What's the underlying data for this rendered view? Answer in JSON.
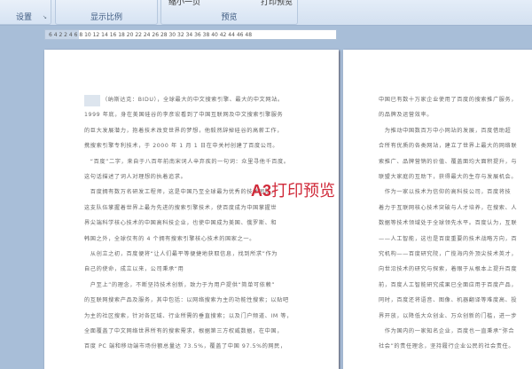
{
  "ribbon": {
    "groups": [
      {
        "label": "设置"
      },
      {
        "label": "显示比例"
      },
      {
        "label": "预览"
      }
    ],
    "buttons": {
      "prev_page": "缩小一页",
      "print_preview": "打印预览"
    }
  },
  "ruler": {
    "ticks": "6  4  2      2   4   6   8  10  12  14  16  18  20  22  24  26  28  30  32  34  36  38  40  42  44  46  48"
  },
  "watermark": {
    "prefix": "A3",
    "text": "打印预览"
  },
  "page1": {
    "lines": [
      "（纳斯达克：BIDU），全球最大的中文搜索引擎、最大的中文网站。",
      "1999 年底，身在美国硅谷的李彦宏看到了中国互联网及中文搜索引擎服务",
      "的巨大发展潜力，抱着技术改变世界的梦想，他毅然辞掉硅谷的高薪工作，",
      "携搜索引擎专利技术，于  2000 年 1 月 1 日在中关村创建了百度公司。",
      "　“百度”二字，来自于八百年前南宋词人辛弃疾的一句词：众里寻他千百度。",
      "这句话描述了词人对理想的执着追求。",
      "　百度拥有数万名研发工程师，这是中国乃至全球最为优秀的技术团队，",
      "这支队伍掌握着世界上最为先进的搜索引擎技术，使百度成为中国掌握世",
      "界尖端科学核心技术的中国高科技企业，也使中国成为美国、俄罗斯、和",
      "韩国之外，全球仅有的 4 个拥有搜索引擎核心技术的国家之一。",
      "　从创立之初，百度便将“让人们最平等便捷地获取信息，找到所求”作为",
      "自己的使命，成立以来，公司秉承“用",
      "　户至上”的理念，不断坚持技术创新，致力于为用户提供“简单可依赖”",
      "的互联网搜索产品及服务，其中包括：以网络搜索为主的功能性搜索；以贴吧",
      "为主的社区搜索，针对各区域、行业所需的垂直搜索；以及门户频道、IM 等，",
      "全面覆盖了中文网络世界所有的搜索需求，根据第三方权威数据，在中国，",
      "百度 PC 端和移动端市场份额总量达 73.5%，覆盖了中国 97.5%的网民，"
    ]
  },
  "page2": {
    "lines": [
      "中国已有数十万家企业使用了百度的搜索推广服务，",
      "的品牌及运营效率。",
      "　为推动中国数百万中小网站的发展，百度借助超",
      "合所有优质的各类网站，建立了世界上最大的网络联",
      "索推广、品牌营销的价值、覆盖面均大面积提升，与",
      "联盟大家庭的互助下，获得最大的生存与发展机会。",
      "　作为一家以技术为信仰的高科技公司，百度将技",
      "着力于互联网核心技术突破与人才培养，在搜索、人",
      "数据等技术领域处于全球领先水平。百度认为，互联",
      "——人工智能，这也是百度重要的技术战略方向，百",
      "究机构——百度研究院，广揽海内外顶尖技术英才，",
      "向世沿技术的研究与探索，着眼于从根本上提升百度",
      "前，百度人工智能研究成果已全面应用于百度产品，",
      "同时，百度还将语音、图像、机器翻译等难度高、投",
      "界开放，以降低大众创业、万众创新的门槛，进一步",
      "　作为国内的一家知名企业，百度也一直秉承“弥合",
      "社会”的责任理念，坚持履行企业公民的社会责任。"
    ]
  }
}
